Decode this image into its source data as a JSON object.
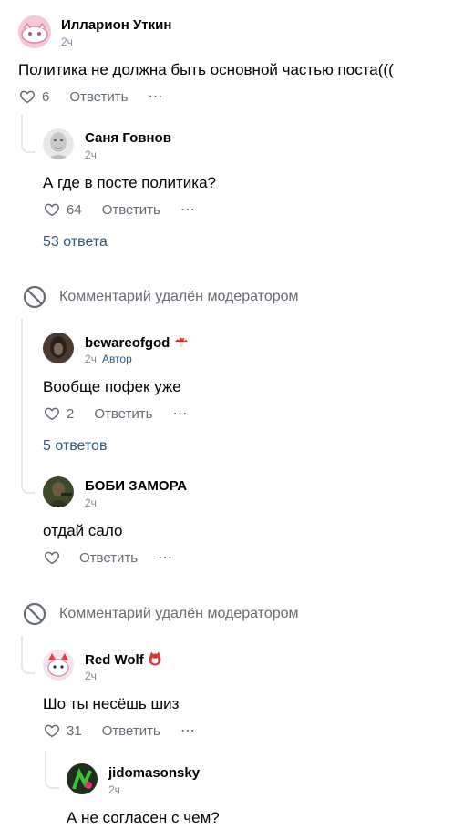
{
  "comments": [
    {
      "author": "Илларион Уткин",
      "time": "2ч",
      "text": "Политика не должна быть основной частью поста(((",
      "likes": "6",
      "reply": "Ответить"
    },
    {
      "author": "Саня Говнов",
      "time": "2ч",
      "text": "А где в посте политика?",
      "likes": "64",
      "reply": "Ответить",
      "replies_link": "53 ответа"
    },
    {
      "deleted_text": "Комментарий удалён модератором"
    },
    {
      "author": "bewareofgod",
      "time": "2ч",
      "badge": "Автор",
      "text": "Вообще пофек уже",
      "likes": "2",
      "reply": "Ответить",
      "replies_link": "5 ответов"
    },
    {
      "author": "БОБИ ЗАМОРА",
      "time": "2ч",
      "text": "отдай сало",
      "likes": "",
      "reply": "Ответить"
    },
    {
      "deleted_text": "Комментарий удалён модератором"
    },
    {
      "author": "Red Wolf",
      "time": "2ч",
      "text": "Шо ты несёшь шиз",
      "likes": "31",
      "reply": "Ответить"
    },
    {
      "author": "jidomasonsky",
      "time": "2ч",
      "text": "А не согласен с чем?"
    }
  ],
  "icons": {
    "more": "⋯",
    "heart": "heart-icon",
    "deleted": "block-icon",
    "mushroom": "mushroom-emoji",
    "wolf": "wolf-emoji"
  },
  "colors": {
    "link": "#2a5885",
    "secondary": "#818c99",
    "action": "#656b73",
    "thread": "#e5e7eb"
  }
}
